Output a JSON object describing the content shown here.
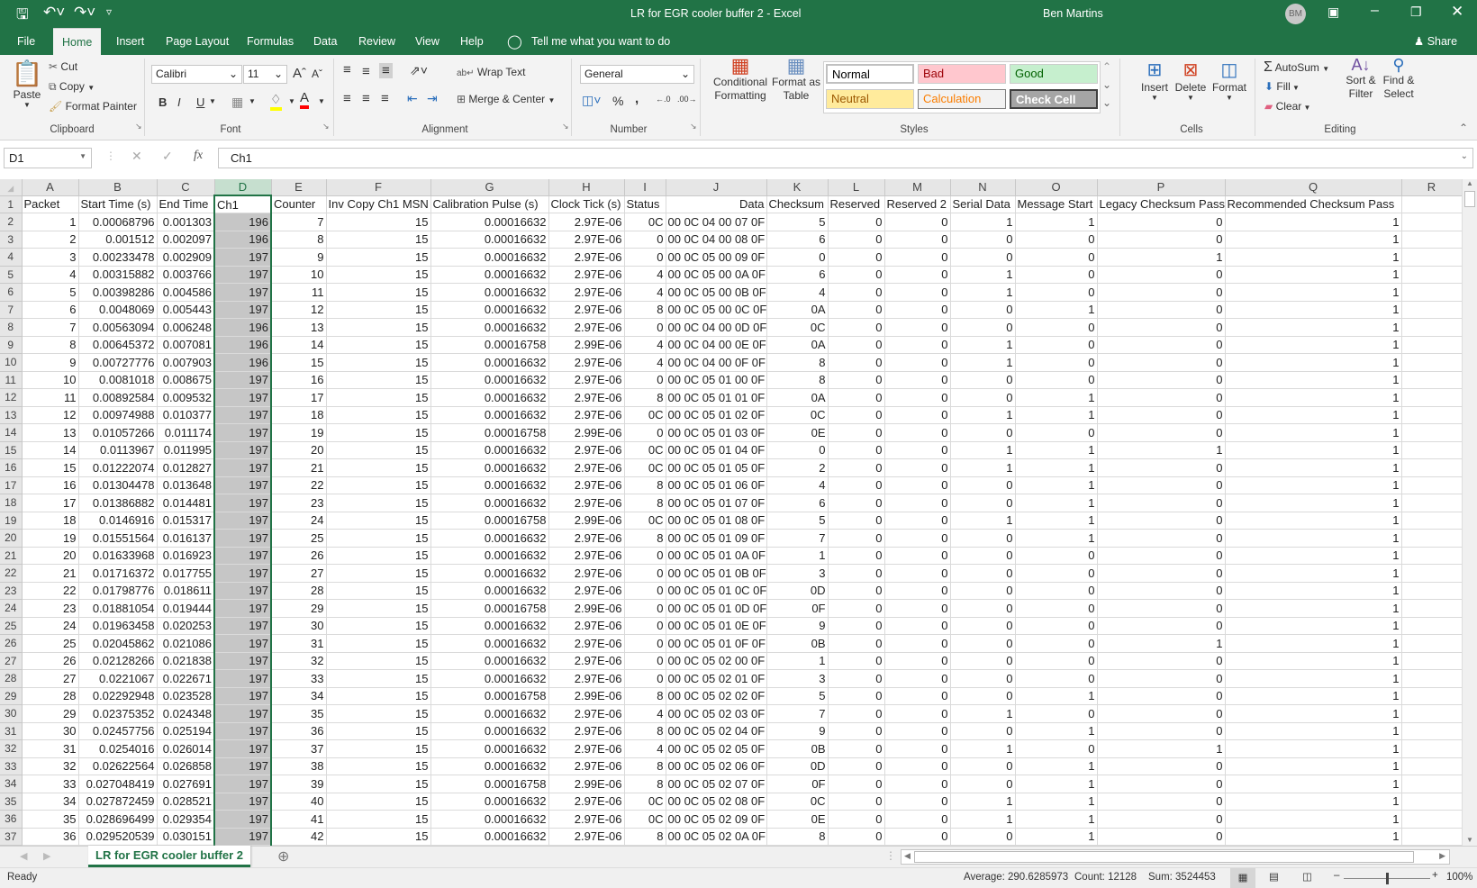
{
  "titlebar": {
    "title": "LR for EGR cooler buffer 2  -  Excel",
    "user": "Ben Martins",
    "avatar": "BM"
  },
  "tabs": [
    "File",
    "Home",
    "Insert",
    "Page Layout",
    "Formulas",
    "Data",
    "Review",
    "View",
    "Help"
  ],
  "tell_me": "Tell me what you want to do",
  "share": "Share",
  "ribbon": {
    "clipboard": {
      "label": "Clipboard",
      "paste": "Paste",
      "cut": "Cut",
      "copy": "Copy",
      "format_painter": "Format Painter"
    },
    "font": {
      "label": "Font",
      "name": "Calibri",
      "size": "11",
      "bold": "B",
      "italic": "I",
      "underline": "U",
      "highlight_color": "#ffff00",
      "font_color": "#ff0000"
    },
    "alignment": {
      "label": "Alignment",
      "wrap_text": "Wrap Text",
      "merge_center": "Merge & Center"
    },
    "number": {
      "label": "Number",
      "format": "General",
      "percent": "%",
      "comma": ","
    },
    "styles": {
      "label": "Styles",
      "conditional_formatting": "Conditional Formatting",
      "format_as_table": "Format as Table",
      "gallery": [
        {
          "name": "Normal",
          "bg": "#ffffff",
          "fg": "#000000"
        },
        {
          "name": "Bad",
          "bg": "#ffc7ce",
          "fg": "#9c0006"
        },
        {
          "name": "Good",
          "bg": "#c6efce",
          "fg": "#006100"
        },
        {
          "name": "Neutral",
          "bg": "#ffeb9c",
          "fg": "#9c5700"
        },
        {
          "name": "Calculation",
          "bg": "#f2f2f2",
          "fg": "#fa7d00"
        },
        {
          "name": "Check Cell",
          "bg": "#a5a5a5",
          "fg": "#ffffff"
        }
      ]
    },
    "cells": {
      "label": "Cells",
      "insert": "Insert",
      "delete": "Delete",
      "format": "Format"
    },
    "editing": {
      "label": "Editing",
      "autosum": "AutoSum",
      "fill": "Fill",
      "clear": "Clear",
      "sort_filter": "Sort & Filter",
      "find_select": "Find & Select"
    }
  },
  "formula_bar": {
    "name_box": "D1",
    "formula": "Ch1",
    "fx": "fx"
  },
  "sheet": {
    "columns": [
      "A",
      "B",
      "C",
      "D",
      "E",
      "F",
      "G",
      "H",
      "I",
      "J",
      "K",
      "L",
      "M",
      "N",
      "O",
      "P",
      "Q",
      "R"
    ],
    "selected_column": "D",
    "headers": [
      "Packet",
      "Start Time (s)",
      "End Time",
      "Ch1",
      "Counter",
      "Inv Copy Ch1 MSN",
      "Calibration Pulse (s)",
      "Clock Tick (s)",
      "Status",
      "Data",
      "Checksum",
      "Reserved",
      "Reserved 2",
      "Serial Data",
      "Message Start",
      "Legacy Checksum Pass",
      "Recommended Checksum Pass"
    ],
    "rows": [
      [
        "1",
        "0.00068796",
        "0.001303",
        "196",
        "7",
        "15",
        "0.00016632",
        "2.97E-06",
        "0C",
        "00 0C 04 00 07 0F",
        "5",
        "0",
        "0",
        "1",
        "1",
        "0",
        "1"
      ],
      [
        "2",
        "0.001512",
        "0.002097",
        "196",
        "8",
        "15",
        "0.00016632",
        "2.97E-06",
        "0",
        "00 0C 04 00 08 0F",
        "6",
        "0",
        "0",
        "0",
        "0",
        "0",
        "1"
      ],
      [
        "3",
        "0.00233478",
        "0.002909",
        "197",
        "9",
        "15",
        "0.00016632",
        "2.97E-06",
        "0",
        "00 0C 05 00 09 0F",
        "0",
        "0",
        "0",
        "0",
        "0",
        "1",
        "1"
      ],
      [
        "4",
        "0.00315882",
        "0.003766",
        "197",
        "10",
        "15",
        "0.00016632",
        "2.97E-06",
        "4",
        "00 0C 05 00 0A 0F",
        "6",
        "0",
        "0",
        "1",
        "0",
        "0",
        "1"
      ],
      [
        "5",
        "0.00398286",
        "0.004586",
        "197",
        "11",
        "15",
        "0.00016632",
        "2.97E-06",
        "4",
        "00 0C 05 00 0B 0F",
        "4",
        "0",
        "0",
        "1",
        "0",
        "0",
        "1"
      ],
      [
        "6",
        "0.0048069",
        "0.005443",
        "197",
        "12",
        "15",
        "0.00016632",
        "2.97E-06",
        "8",
        "00 0C 05 00 0C 0F",
        "0A",
        "0",
        "0",
        "0",
        "1",
        "0",
        "1"
      ],
      [
        "7",
        "0.00563094",
        "0.006248",
        "196",
        "13",
        "15",
        "0.00016632",
        "2.97E-06",
        "0",
        "00 0C 04 00 0D 0F",
        "0C",
        "0",
        "0",
        "0",
        "0",
        "0",
        "1"
      ],
      [
        "8",
        "0.00645372",
        "0.007081",
        "196",
        "14",
        "15",
        "0.00016758",
        "2.99E-06",
        "4",
        "00 0C 04 00 0E 0F",
        "0A",
        "0",
        "0",
        "1",
        "0",
        "0",
        "1"
      ],
      [
        "9",
        "0.00727776",
        "0.007903",
        "196",
        "15",
        "15",
        "0.00016632",
        "2.97E-06",
        "4",
        "00 0C 04 00 0F 0F",
        "8",
        "0",
        "0",
        "1",
        "0",
        "0",
        "1"
      ],
      [
        "10",
        "0.0081018",
        "0.008675",
        "197",
        "16",
        "15",
        "0.00016632",
        "2.97E-06",
        "0",
        "00 0C 05 01 00 0F",
        "8",
        "0",
        "0",
        "0",
        "0",
        "0",
        "1"
      ],
      [
        "11",
        "0.00892584",
        "0.009532",
        "197",
        "17",
        "15",
        "0.00016632",
        "2.97E-06",
        "8",
        "00 0C 05 01 01 0F",
        "0A",
        "0",
        "0",
        "0",
        "1",
        "0",
        "1"
      ],
      [
        "12",
        "0.00974988",
        "0.010377",
        "197",
        "18",
        "15",
        "0.00016632",
        "2.97E-06",
        "0C",
        "00 0C 05 01 02 0F",
        "0C",
        "0",
        "0",
        "1",
        "1",
        "0",
        "1"
      ],
      [
        "13",
        "0.01057266",
        "0.011174",
        "197",
        "19",
        "15",
        "0.00016758",
        "2.99E-06",
        "0",
        "00 0C 05 01 03 0F",
        "0E",
        "0",
        "0",
        "0",
        "0",
        "0",
        "1"
      ],
      [
        "14",
        "0.0113967",
        "0.011995",
        "197",
        "20",
        "15",
        "0.00016632",
        "2.97E-06",
        "0C",
        "00 0C 05 01 04 0F",
        "0",
        "0",
        "0",
        "1",
        "1",
        "1",
        "1"
      ],
      [
        "15",
        "0.01222074",
        "0.012827",
        "197",
        "21",
        "15",
        "0.00016632",
        "2.97E-06",
        "0C",
        "00 0C 05 01 05 0F",
        "2",
        "0",
        "0",
        "1",
        "1",
        "0",
        "1"
      ],
      [
        "16",
        "0.01304478",
        "0.013648",
        "197",
        "22",
        "15",
        "0.00016632",
        "2.97E-06",
        "8",
        "00 0C 05 01 06 0F",
        "4",
        "0",
        "0",
        "0",
        "1",
        "0",
        "1"
      ],
      [
        "17",
        "0.01386882",
        "0.014481",
        "197",
        "23",
        "15",
        "0.00016632",
        "2.97E-06",
        "8",
        "00 0C 05 01 07 0F",
        "6",
        "0",
        "0",
        "0",
        "1",
        "0",
        "1"
      ],
      [
        "18",
        "0.0146916",
        "0.015317",
        "197",
        "24",
        "15",
        "0.00016758",
        "2.99E-06",
        "0C",
        "00 0C 05 01 08 0F",
        "5",
        "0",
        "0",
        "1",
        "1",
        "0",
        "1"
      ],
      [
        "19",
        "0.01551564",
        "0.016137",
        "197",
        "25",
        "15",
        "0.00016632",
        "2.97E-06",
        "8",
        "00 0C 05 01 09 0F",
        "7",
        "0",
        "0",
        "0",
        "1",
        "0",
        "1"
      ],
      [
        "20",
        "0.01633968",
        "0.016923",
        "197",
        "26",
        "15",
        "0.00016632",
        "2.97E-06",
        "0",
        "00 0C 05 01 0A 0F",
        "1",
        "0",
        "0",
        "0",
        "0",
        "0",
        "1"
      ],
      [
        "21",
        "0.01716372",
        "0.017755",
        "197",
        "27",
        "15",
        "0.00016632",
        "2.97E-06",
        "0",
        "00 0C 05 01 0B 0F",
        "3",
        "0",
        "0",
        "0",
        "0",
        "0",
        "1"
      ],
      [
        "22",
        "0.01798776",
        "0.018611",
        "197",
        "28",
        "15",
        "0.00016632",
        "2.97E-06",
        "0",
        "00 0C 05 01 0C 0F",
        "0D",
        "0",
        "0",
        "0",
        "0",
        "0",
        "1"
      ],
      [
        "23",
        "0.01881054",
        "0.019444",
        "197",
        "29",
        "15",
        "0.00016758",
        "2.99E-06",
        "0",
        "00 0C 05 01 0D 0F",
        "0F",
        "0",
        "0",
        "0",
        "0",
        "0",
        "1"
      ],
      [
        "24",
        "0.01963458",
        "0.020253",
        "197",
        "30",
        "15",
        "0.00016632",
        "2.97E-06",
        "0",
        "00 0C 05 01 0E 0F",
        "9",
        "0",
        "0",
        "0",
        "0",
        "0",
        "1"
      ],
      [
        "25",
        "0.02045862",
        "0.021086",
        "197",
        "31",
        "15",
        "0.00016632",
        "2.97E-06",
        "0",
        "00 0C 05 01 0F 0F",
        "0B",
        "0",
        "0",
        "0",
        "0",
        "1",
        "1"
      ],
      [
        "26",
        "0.02128266",
        "0.021838",
        "197",
        "32",
        "15",
        "0.00016632",
        "2.97E-06",
        "0",
        "00 0C 05 02 00 0F",
        "1",
        "0",
        "0",
        "0",
        "0",
        "0",
        "1"
      ],
      [
        "27",
        "0.0221067",
        "0.022671",
        "197",
        "33",
        "15",
        "0.00016632",
        "2.97E-06",
        "0",
        "00 0C 05 02 01 0F",
        "3",
        "0",
        "0",
        "0",
        "0",
        "0",
        "1"
      ],
      [
        "28",
        "0.02292948",
        "0.023528",
        "197",
        "34",
        "15",
        "0.00016758",
        "2.99E-06",
        "8",
        "00 0C 05 02 02 0F",
        "5",
        "0",
        "0",
        "0",
        "1",
        "0",
        "1"
      ],
      [
        "29",
        "0.02375352",
        "0.024348",
        "197",
        "35",
        "15",
        "0.00016632",
        "2.97E-06",
        "4",
        "00 0C 05 02 03 0F",
        "7",
        "0",
        "0",
        "1",
        "0",
        "0",
        "1"
      ],
      [
        "30",
        "0.02457756",
        "0.025194",
        "197",
        "36",
        "15",
        "0.00016632",
        "2.97E-06",
        "8",
        "00 0C 05 02 04 0F",
        "9",
        "0",
        "0",
        "0",
        "1",
        "0",
        "1"
      ],
      [
        "31",
        "0.0254016",
        "0.026014",
        "197",
        "37",
        "15",
        "0.00016632",
        "2.97E-06",
        "4",
        "00 0C 05 02 05 0F",
        "0B",
        "0",
        "0",
        "1",
        "0",
        "1",
        "1"
      ],
      [
        "32",
        "0.02622564",
        "0.026858",
        "197",
        "38",
        "15",
        "0.00016632",
        "2.97E-06",
        "8",
        "00 0C 05 02 06 0F",
        "0D",
        "0",
        "0",
        "0",
        "1",
        "0",
        "1"
      ],
      [
        "33",
        "0.027048419",
        "0.027691",
        "197",
        "39",
        "15",
        "0.00016758",
        "2.99E-06",
        "8",
        "00 0C 05 02 07 0F",
        "0F",
        "0",
        "0",
        "0",
        "1",
        "0",
        "1"
      ],
      [
        "34",
        "0.027872459",
        "0.028521",
        "197",
        "40",
        "15",
        "0.00016632",
        "2.97E-06",
        "0C",
        "00 0C 05 02 08 0F",
        "0C",
        "0",
        "0",
        "1",
        "1",
        "0",
        "1"
      ],
      [
        "35",
        "0.028696499",
        "0.029354",
        "197",
        "41",
        "15",
        "0.00016632",
        "2.97E-06",
        "0C",
        "00 0C 05 02 09 0F",
        "0E",
        "0",
        "0",
        "1",
        "1",
        "0",
        "1"
      ],
      [
        "36",
        "0.029520539",
        "0.030151",
        "197",
        "42",
        "15",
        "0.00016632",
        "2.97E-06",
        "8",
        "00 0C 05 02 0A 0F",
        "8",
        "0",
        "0",
        "0",
        "1",
        "0",
        "1"
      ]
    ]
  },
  "sheet_tab": "LR for EGR cooler buffer 2",
  "status": {
    "ready": "Ready",
    "average": "Average: 290.6285973",
    "count": "Count: 12128",
    "sum": "Sum: 3524453",
    "zoom": "100%",
    "zoom_level": 100
  },
  "colors": {
    "accent": "#217346",
    "ribbon_bg": "#f3f3f3"
  }
}
